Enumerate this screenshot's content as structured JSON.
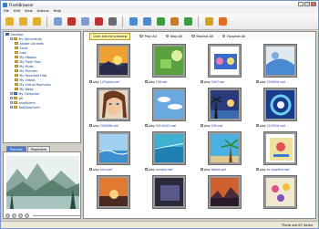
{
  "window": {
    "title": "FlashBrowser"
  },
  "menu": [
    "File",
    "Edit",
    "View",
    "Actions",
    "Help"
  ],
  "toolbar": [
    "folder-up-icon",
    "folder-open-icon",
    "favorites-icon",
    "copy-icon",
    "cut-icon",
    "paste-icon",
    "delete-icon",
    "properties-icon",
    "thumbnails-icon",
    "details-icon",
    "globe-icon",
    "capture-icon",
    "refresh-icon",
    "info-icon",
    "help-icon"
  ],
  "tree": [
    {
      "label": "Desktop",
      "level": 0,
      "kind": "desk"
    },
    {
      "label": "My Documents",
      "level": 1,
      "kind": "folder"
    },
    {
      "label": "Adobe Libraries",
      "level": 2,
      "kind": "folder"
    },
    {
      "label": "Excel",
      "level": 2,
      "kind": "folder"
    },
    {
      "label": "Intel",
      "level": 2,
      "kind": "folder"
    },
    {
      "label": "My eBooks",
      "level": 2,
      "kind": "folder"
    },
    {
      "label": "My Flash Files",
      "level": 2,
      "kind": "folder"
    },
    {
      "label": "My Music",
      "level": 2,
      "kind": "folder"
    },
    {
      "label": "My Pictures",
      "level": 2,
      "kind": "folder"
    },
    {
      "label": "My Received Files",
      "level": 2,
      "kind": "folder"
    },
    {
      "label": "My Videos",
      "level": 2,
      "kind": "folder"
    },
    {
      "label": "My Virtual Machines",
      "level": 2,
      "kind": "folder"
    },
    {
      "label": "My Webs",
      "level": 2,
      "kind": "folder"
    },
    {
      "label": "My Computer",
      "level": 1,
      "kind": "pc"
    },
    {
      "label": "gfi",
      "level": 1,
      "kind": "folder"
    },
    {
      "label": "photAdmin",
      "level": 1,
      "kind": "folder"
    },
    {
      "label": "ToolDemForm",
      "level": 1,
      "kind": "folder"
    }
  ],
  "preview_tabs": {
    "preview": "Preview",
    "properties": "Properties"
  },
  "main_bar": {
    "preview_button": "Click link for preview",
    "play_all": "Play All",
    "stop_all": "Stop All",
    "rewind_all": "Rewind All",
    "forward_all": "Forward All"
  },
  "cards": [
    {
      "play": "play",
      "name": "12Flydod.swf",
      "scene": "sunset"
    },
    {
      "play": "play",
      "name": "158.swf",
      "scene": "green"
    },
    {
      "play": "play",
      "name": "1947.swf",
      "scene": "icecream"
    },
    {
      "play": "play",
      "name": "200904c.swf",
      "scene": "abstract"
    },
    {
      "play": "play",
      "name": "200906c.swf",
      "scene": "woman"
    },
    {
      "play": "play",
      "name": "20100401.swf",
      "scene": "sky"
    },
    {
      "play": "play",
      "name": "209.swf",
      "scene": "beach"
    },
    {
      "play": "play",
      "name": "222904c.swf",
      "scene": "swirl"
    },
    {
      "play": "play",
      "name": "arcs.swf",
      "scene": "water"
    },
    {
      "play": "play",
      "name": "accepts.swf",
      "scene": "aqua"
    },
    {
      "play": "play",
      "name": "biabia.swf",
      "scene": "palm"
    },
    {
      "play": "play",
      "name": "bc-together.swf",
      "scene": "card"
    },
    {
      "play": "",
      "name": "",
      "scene": "sunset2"
    },
    {
      "play": "",
      "name": "",
      "scene": "dark"
    },
    {
      "play": "",
      "name": "",
      "scene": "sunset3"
    },
    {
      "play": "",
      "name": "",
      "scene": "flowers"
    }
  ],
  "status": {
    "count": "There are 87 items"
  }
}
